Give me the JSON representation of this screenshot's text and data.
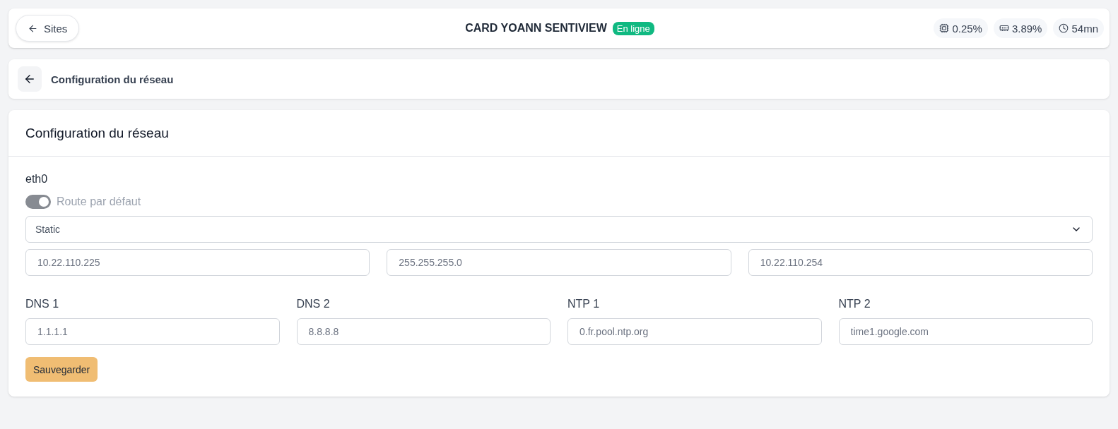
{
  "top_bar": {
    "back_button": {
      "label": "Sites"
    },
    "title": "CARD YOANN SENTIVIEW",
    "status_badge": {
      "label": "En ligne"
    },
    "stats": [
      {
        "kind": "cpu",
        "value": "0.25%"
      },
      {
        "kind": "memory",
        "value": "3.89%"
      },
      {
        "kind": "uptime",
        "value": "54mn"
      }
    ]
  },
  "page_header": {
    "title": "Configuration du réseau"
  },
  "card": {
    "title": "Configuration du réseau",
    "interface": {
      "name": "eth0",
      "default_route": {
        "label": "Route par défaut",
        "checked": true,
        "disabled": true
      },
      "mode_select": {
        "value": "Static"
      },
      "address_fields": [
        {
          "value": "10.22.110.225"
        },
        {
          "value": "255.255.255.0"
        },
        {
          "value": "10.22.110.254"
        }
      ],
      "server_fields": [
        {
          "label": "DNS 1",
          "value": "1.1.1.1"
        },
        {
          "label": "DNS 2",
          "value": "8.8.8.8"
        },
        {
          "label": "NTP 1",
          "value": "0.fr.pool.ntp.org"
        },
        {
          "label": "NTP 2",
          "value": "time1.google.com"
        }
      ]
    },
    "save_button": {
      "label": "Sauvegarder"
    }
  }
}
